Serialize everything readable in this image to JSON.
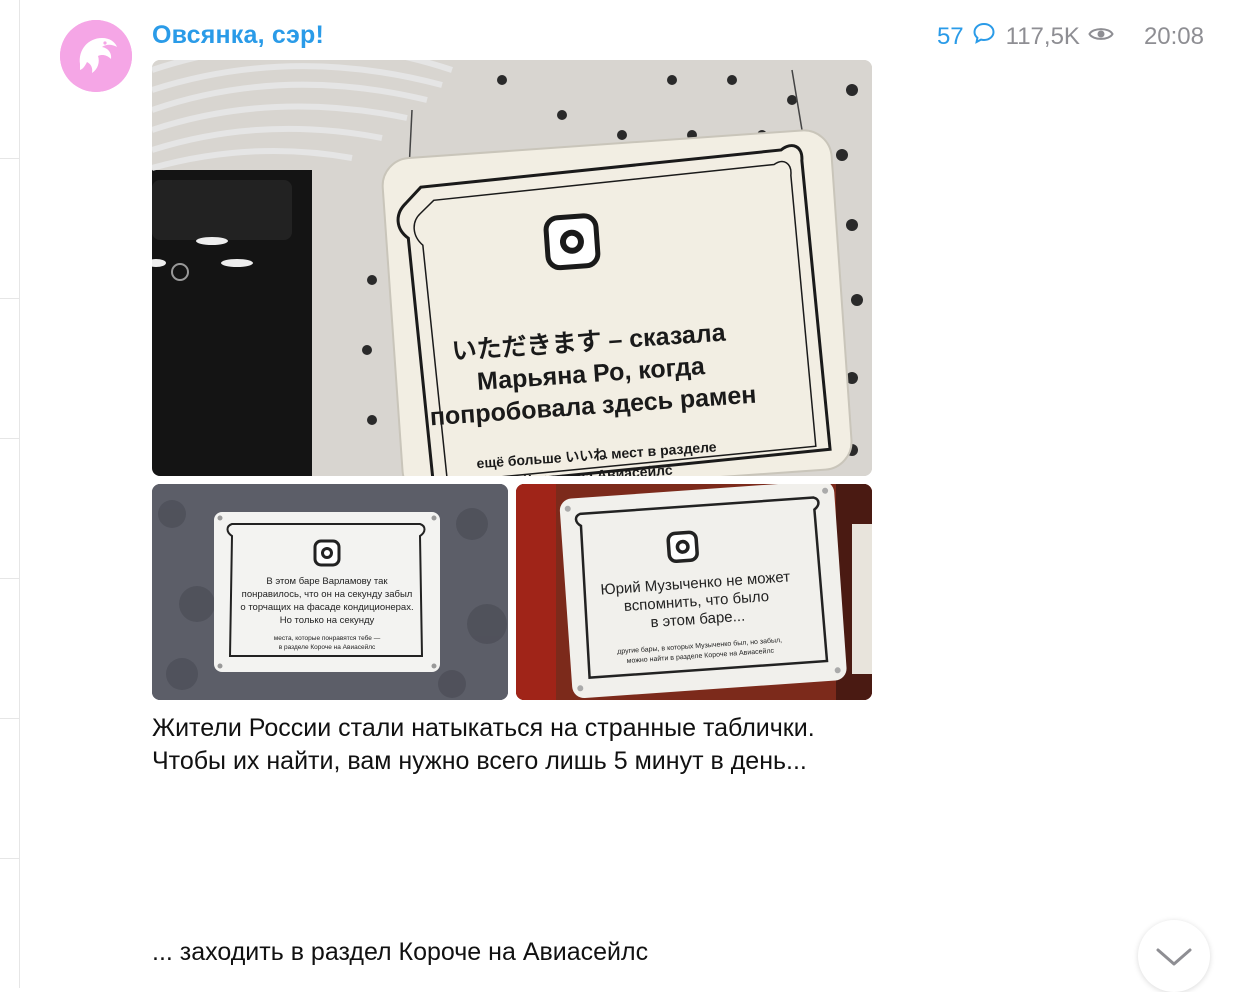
{
  "post": {
    "channel_name": "Овсянка, сэр!",
    "comments_count": "57",
    "views": "117,5K",
    "time": "20:08",
    "caption": "Жители России стали натыкаться на странные таблички. Чтобы их найти, вам нужно всего лишь 5 минут в день...",
    "caption_2": "... заходить в раздел Короче на Авиасейлс"
  },
  "photos": {
    "main": {
      "line1": "いただきます – сказала",
      "line2": "Марьяна Ро, когда",
      "line3": "попробовала здесь рамен",
      "footer1": "ещё больше いいね мест в разделе",
      "footer2": "Короче на Авиасейлс"
    },
    "left": {
      "line1": "В этом баре Варламову так",
      "line2": "понравилось, что он на секунду забыл",
      "line3": "о торчащих на фасаде кондиционерах.",
      "line4": "Но только на секунду",
      "footer1": "места, которые понравятся тебе —",
      "footer2": "в разделе Короче на Авиасейлс"
    },
    "right": {
      "line1": "Юрий Музыченко не может",
      "line2": "вспомнить, что было",
      "line3": "в этом баре...",
      "footer1": "другие бары, в которых Музыченко был, но забыл,",
      "footer2": "можно найти в разделе Короче на Авиасейлс"
    }
  },
  "icons": {
    "comment": "speech-bubble-icon",
    "views": "eye-icon",
    "scroll": "chevron-down-icon",
    "avatar": "dolphin-logo"
  },
  "colors": {
    "accent": "#2a9be8",
    "avatar_bg": "#f5a6e6",
    "meta_gray": "#8e8e93"
  }
}
